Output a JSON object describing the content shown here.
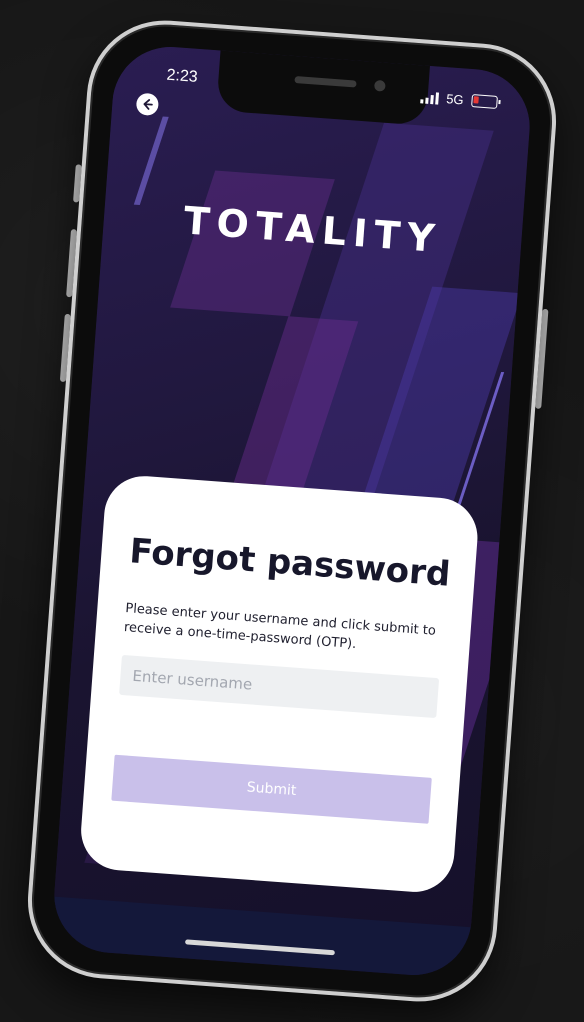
{
  "status_bar": {
    "time": "2:23",
    "network": "5G"
  },
  "app": {
    "logo": "TOTALITY"
  },
  "card": {
    "title": "Forgot password",
    "description": "Please enter your username and click submit to receive a one-time-password (OTP).",
    "username_placeholder": "Enter username",
    "username_value": "",
    "submit_label": "Submit"
  },
  "colors": {
    "accent": "#c9c0ea",
    "background": "#1e1735",
    "card": "#ffffff"
  }
}
